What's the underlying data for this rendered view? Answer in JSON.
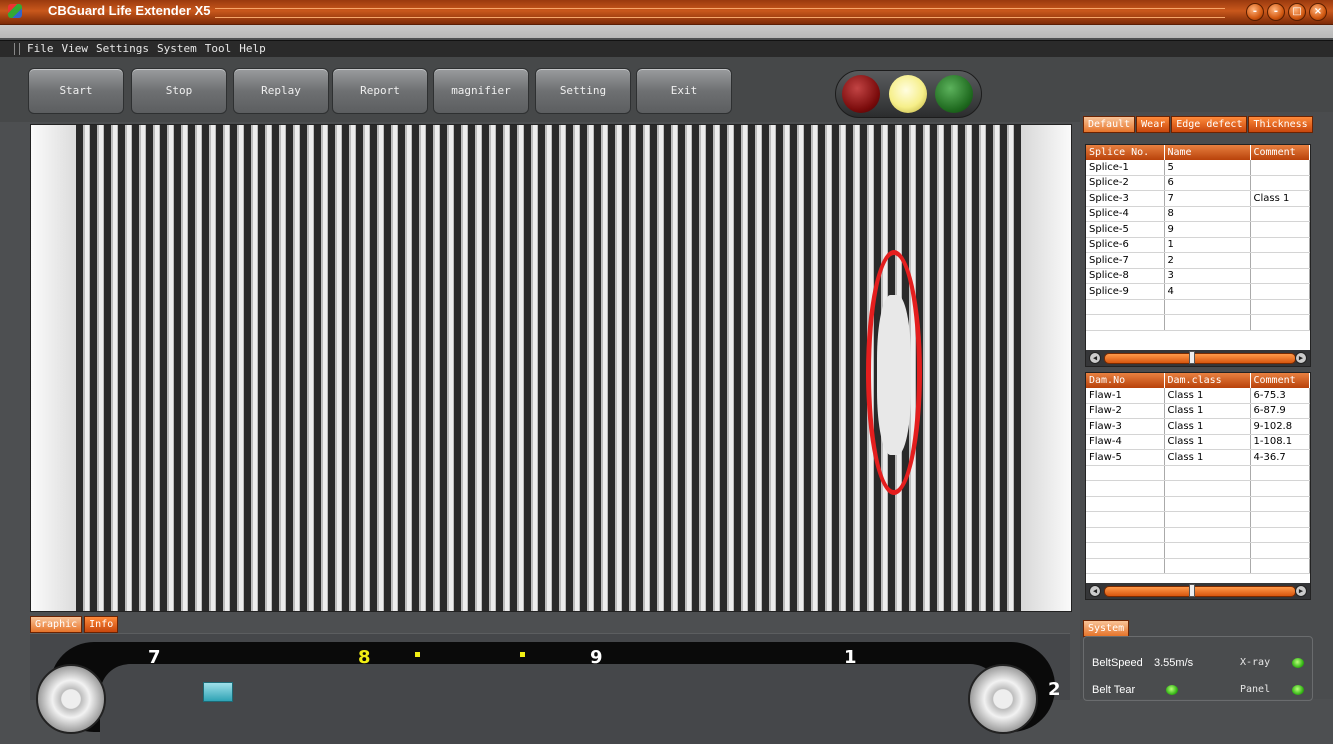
{
  "window": {
    "title": "CBGuard Life Extender X5",
    "controls": [
      "-",
      "-",
      "□",
      "×"
    ]
  },
  "menu": [
    "File",
    "View",
    "Settings",
    "System",
    "Tool",
    "Help"
  ],
  "toolbar": {
    "buttons": [
      "Start",
      "Stop",
      "Replay",
      "Report",
      "magnifier",
      "Setting",
      "Exit"
    ]
  },
  "traffic_lights": {
    "red": "#8b0f0f",
    "yellow": "#f6ef8a",
    "green": "#1f6a1f"
  },
  "right_tabs": [
    "Default",
    "Wear",
    "Edge defect",
    "Thickness"
  ],
  "splice_table": {
    "headers": [
      "Splice No.",
      "Name",
      "Comment"
    ],
    "rows": [
      [
        "Splice-1",
        "5",
        ""
      ],
      [
        "Splice-2",
        "6",
        ""
      ],
      [
        "Splice-3",
        "7",
        "Class 1"
      ],
      [
        "Splice-4",
        "8",
        ""
      ],
      [
        "Splice-5",
        "9",
        ""
      ],
      [
        "Splice-6",
        "1",
        ""
      ],
      [
        "Splice-7",
        "2",
        ""
      ],
      [
        "Splice-8",
        "3",
        ""
      ],
      [
        "Splice-9",
        "4",
        ""
      ],
      [
        "",
        "",
        ""
      ],
      [
        "",
        "",
        ""
      ]
    ]
  },
  "damage_table": {
    "headers": [
      "Dam.No",
      "Dam.class",
      "Comment"
    ],
    "rows": [
      [
        "Flaw-1",
        "Class 1",
        "6-75.3"
      ],
      [
        "Flaw-2",
        "Class 1",
        "6-87.9"
      ],
      [
        "Flaw-3",
        "Class 1",
        "9-102.8"
      ],
      [
        "Flaw-4",
        "Class 1",
        "1-108.1"
      ],
      [
        "Flaw-5",
        "Class 1",
        "4-36.7"
      ],
      [
        "",
        "",
        ""
      ],
      [
        "",
        "",
        ""
      ],
      [
        "",
        "",
        ""
      ],
      [
        "",
        "",
        ""
      ],
      [
        "",
        "",
        ""
      ],
      [
        "",
        "",
        ""
      ],
      [
        "",
        "",
        ""
      ]
    ]
  },
  "bottom_tabs": [
    "Graphic",
    "Info"
  ],
  "belt_graphic": {
    "splice_labels": [
      "7",
      "8",
      "9",
      "1",
      "2"
    ],
    "highlighted": "8"
  },
  "system": {
    "tab": "System",
    "belt_speed_label": "BeltSpeed",
    "belt_speed_value": "3.55m/s",
    "belt_tear_label": "Belt Tear",
    "xray_label": "X-ray",
    "panel_label": "Panel",
    "led_color": "#38b818"
  },
  "colors": {
    "accent": "#d8560e",
    "flaw_marker": "#e41e1e",
    "highlight": "#f1ef14"
  }
}
